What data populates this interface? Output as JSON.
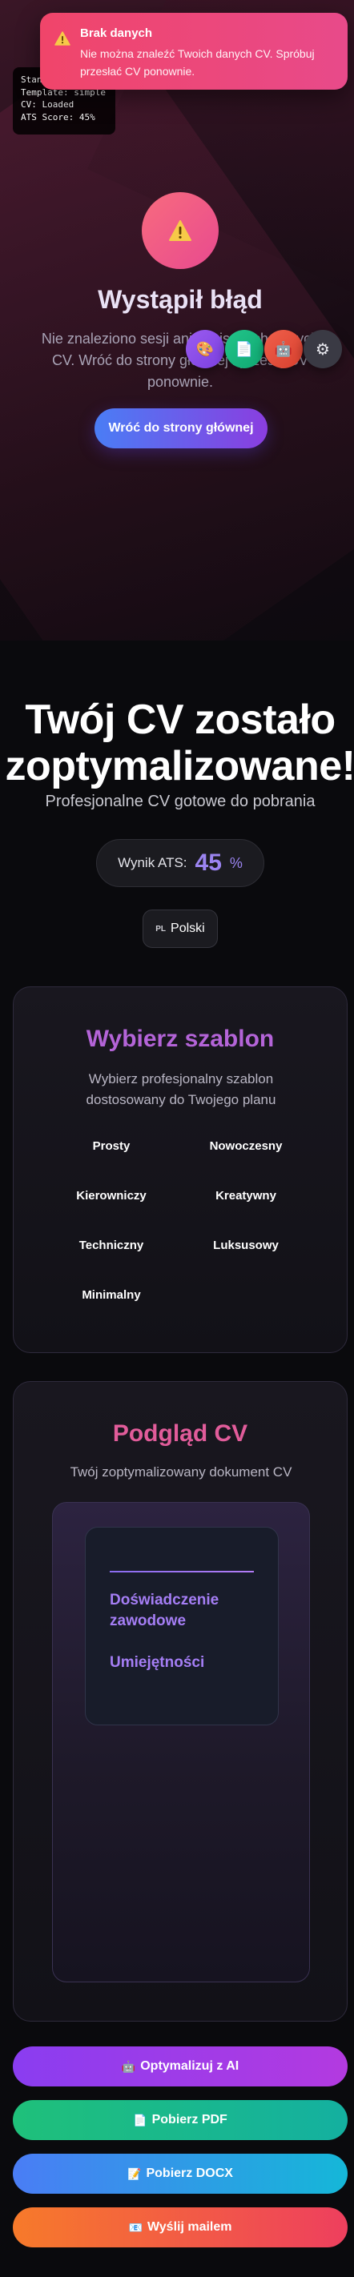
{
  "debug": {
    "lines": [
      "Stan",
      "Template: simple",
      "CV: Loaded",
      "ATS Score: 45%"
    ]
  },
  "toast": {
    "title": "Brak danych",
    "message": "Nie można znaleźć Twoich danych CV. Spróbuj przesłać CV ponownie."
  },
  "error": {
    "icon": "warning-icon",
    "title": "Wystąpił błąd",
    "text": "Nie znaleziono sesji ani zapisanych danych CV. Wróć do strony głównej i prześlij CV ponownie.",
    "button_label": "Wróć do strony głównej"
  },
  "floating_buttons": [
    {
      "icon": "palette-icon",
      "glyph": "🎨",
      "color": "#9b5cf0"
    },
    {
      "icon": "document-icon",
      "glyph": "📄",
      "color": "#22c58a"
    },
    {
      "icon": "robot-icon",
      "glyph": "🤖",
      "color": "#f0604b"
    },
    {
      "icon": "gear-icon",
      "glyph": "⚙",
      "color": "#3a3a44"
    }
  ],
  "hero": {
    "title_line1": "Twój CV zostało",
    "title_line2": "zoptymalizowane!",
    "subtitle": "Profesjonalne CV gotowe do pobrania"
  },
  "ats": {
    "label": "Wynik ATS:",
    "value": "45",
    "unit": "%"
  },
  "language": {
    "flag": "PL",
    "label": "Polski"
  },
  "templates": {
    "title": "Wybierz szablon",
    "description": "Wybierz profesjonalny szablon dostosowany do Twojego planu",
    "items": [
      "Prosty",
      "Nowoczesny",
      "Kierowniczy",
      "Kreatywny",
      "Techniczny",
      "Luksusowy",
      "Minimalny"
    ]
  },
  "preview": {
    "title": "Podgląd CV",
    "description": "Twój zoptymalizowany dokument CV",
    "section1": "Doświadczenie zawodowe",
    "section2": "Umiejętności"
  },
  "actions": {
    "ai": {
      "icon": "🤖",
      "label": "Optymalizuj z AI"
    },
    "pdf": {
      "icon": "📄",
      "label": "Pobierz PDF"
    },
    "docx": {
      "icon": "📝",
      "label": "Pobierz DOCX"
    },
    "mail": {
      "icon": "📧",
      "label": "Wyślij mailem"
    }
  },
  "colors": {
    "accent_purple": "#9b84f0",
    "title_purple": "#b464d8",
    "title_pink": "#e15c9a",
    "toast": "#f0456a"
  }
}
